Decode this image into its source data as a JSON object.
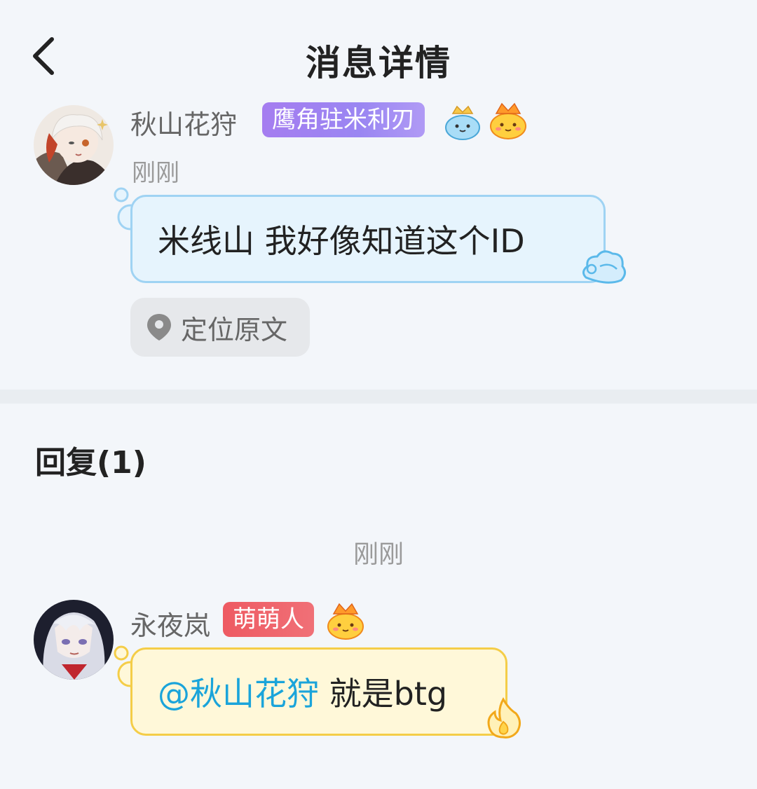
{
  "header": {
    "title": "消息详情",
    "back_icon": "back-arrow-icon"
  },
  "message": {
    "username": "秋山花狩",
    "title_badge": "鹰角驻米利刃",
    "time": "刚刚",
    "content": "米线山 我好像知道这个ID",
    "locate_label": "定位原文"
  },
  "replies": {
    "header": "回复(1)",
    "time": "刚刚",
    "items": [
      {
        "username": "永夜岚",
        "title_badge": "萌萌人",
        "mention": "@秋山花狩",
        "content": " 就是btg"
      }
    ]
  },
  "colors": {
    "bubble_blue_border": "#9fd3f3",
    "bubble_yellow_border": "#f4cd48",
    "mention": "#1aa4da",
    "badge_purple": "#a57df0",
    "badge_red": "#ee5a62"
  }
}
